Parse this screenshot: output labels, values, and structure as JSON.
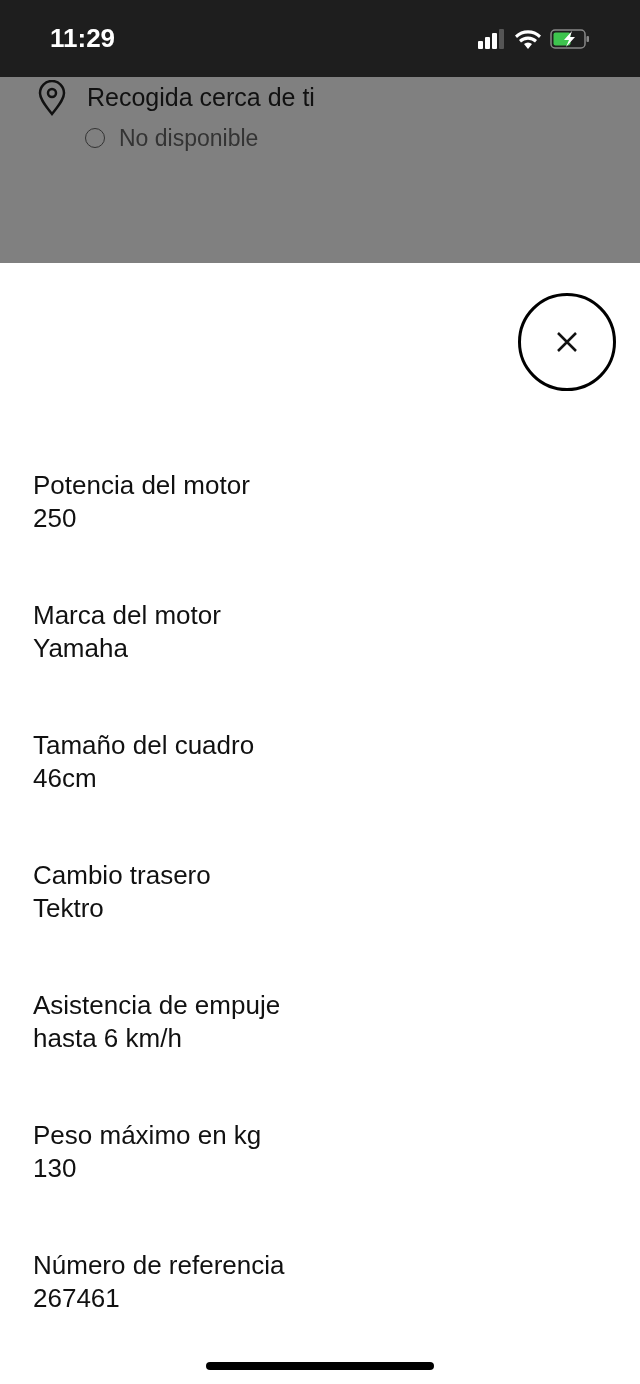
{
  "status_bar": {
    "time": "11:29"
  },
  "background": {
    "pickup_label": "Recogida cerca de ti",
    "availability": {
      "label": "No disponible",
      "selected": false
    }
  },
  "specs": [
    {
      "label": "Potencia del motor",
      "value": "250"
    },
    {
      "label": "Marca del motor",
      "value": "Yamaha"
    },
    {
      "label": "Tamaño del cuadro",
      "value": "46cm"
    },
    {
      "label": "Cambio trasero",
      "value": "Tektro"
    },
    {
      "label": "Asistencia de empuje",
      "value": "hasta 6 km/h"
    },
    {
      "label": "Peso máximo en kg",
      "value": "130"
    },
    {
      "label": "Número de referencia",
      "value": "267461"
    }
  ]
}
